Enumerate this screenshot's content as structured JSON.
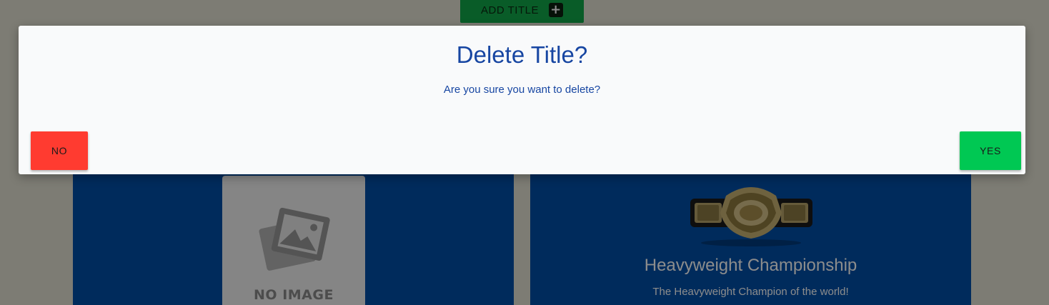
{
  "header": {
    "add_title_label": "ADD TITLE",
    "add_icon": "plus-icon"
  },
  "cards": [
    {
      "image_placeholder": "NO IMAGE",
      "image_icon": "image-placeholder-icon"
    },
    {
      "image_icon": "championship-belt-image",
      "title": "Heavyweight Championship",
      "description": "The Heavyweight Champion of the world!"
    }
  ],
  "dialog": {
    "title": "Delete Title?",
    "message": "Are you sure you want to delete?",
    "no_label": "NO",
    "yes_label": "YES"
  },
  "colors": {
    "accent_blue": "#1746a2",
    "card_blue": "#004fa8",
    "no_button": "#ff3b30",
    "yes_button": "#00c853",
    "add_button": "#12a84a"
  }
}
